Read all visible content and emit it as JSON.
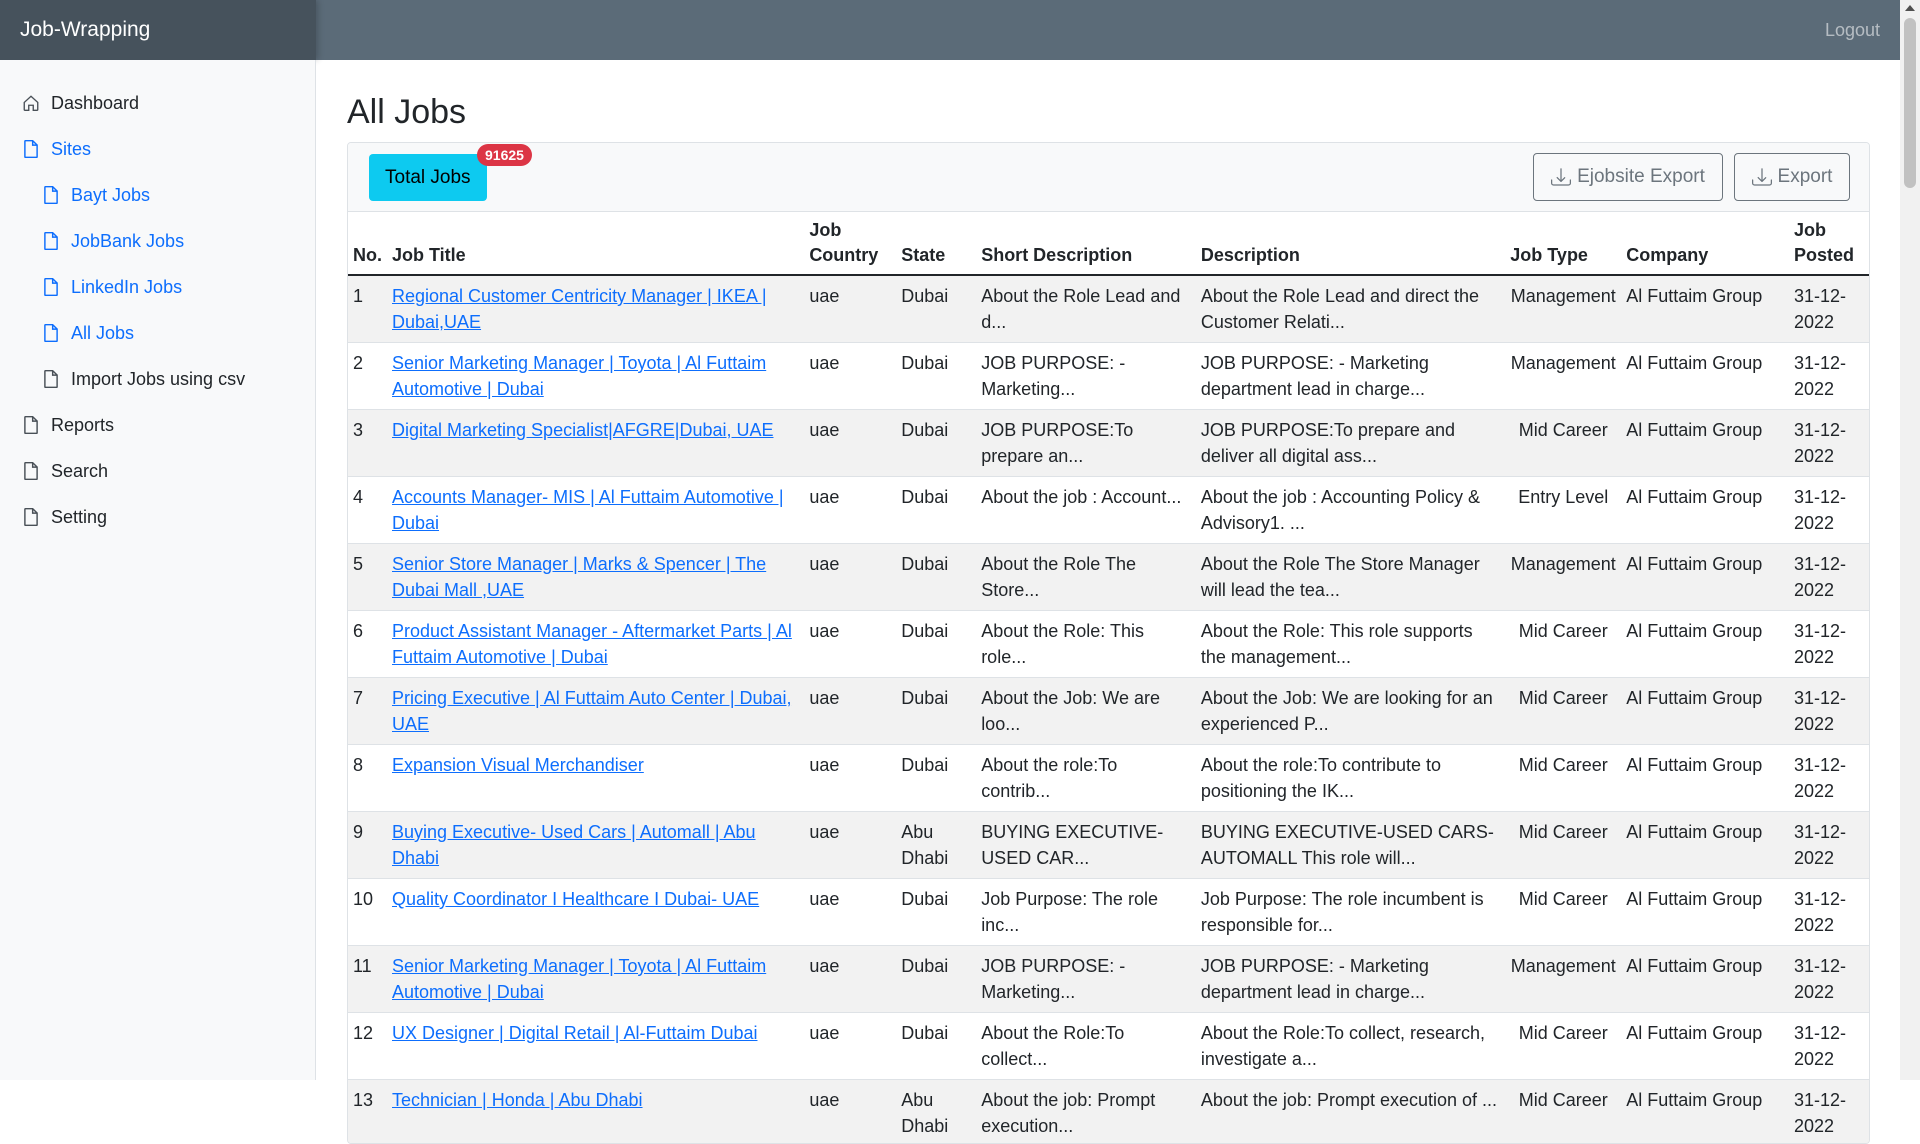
{
  "app": {
    "brand": "Job-Wrapping",
    "logout": "Logout"
  },
  "sidebar": {
    "items": [
      {
        "label": "Dashboard",
        "icon": "home-icon",
        "active": false,
        "sub": false
      },
      {
        "label": "Sites",
        "icon": "file-icon",
        "active": true,
        "sub": false
      },
      {
        "label": "Bayt Jobs",
        "icon": "file-icon",
        "active": true,
        "sub": true
      },
      {
        "label": "JobBank Jobs",
        "icon": "file-icon",
        "active": true,
        "sub": true
      },
      {
        "label": "LinkedIn Jobs",
        "icon": "file-icon",
        "active": true,
        "sub": true
      },
      {
        "label": "All Jobs",
        "icon": "file-icon",
        "active": true,
        "sub": true
      },
      {
        "label": "Import Jobs using csv",
        "icon": "file-icon",
        "active": false,
        "sub": true
      },
      {
        "label": "Reports",
        "icon": "file-icon",
        "active": false,
        "sub": false
      },
      {
        "label": "Search",
        "icon": "file-icon",
        "active": false,
        "sub": false
      },
      {
        "label": "Setting",
        "icon": "file-icon",
        "active": false,
        "sub": false
      }
    ]
  },
  "main": {
    "title": "All Jobs",
    "total_jobs_label": "Total Jobs",
    "total_jobs_count": "91625",
    "ejobsite_export": "Ejobsite Export",
    "export": "Export",
    "columns": [
      "No.",
      "Job Title",
      "Job Country",
      "State",
      "Short Description",
      "Description",
      "Job Type",
      "Company",
      "Job Posted"
    ],
    "rows": [
      {
        "no": "1",
        "title": "Regional Customer Centricity Manager | IKEA | Dubai,UAE",
        "country": "uae",
        "state": "Dubai",
        "short": "About the Role Lead and d...",
        "desc": "About the Role Lead and direct the Customer Relati...",
        "type": "Management",
        "company": "Al Futtaim Group",
        "posted": "31-12-2022"
      },
      {
        "no": "2",
        "title": "Senior Marketing Manager | Toyota | Al Futtaim Automotive | Dubai",
        "country": "uae",
        "state": "Dubai",
        "short": "JOB PURPOSE: - Marketing...",
        "desc": "JOB PURPOSE: - Marketing department lead in charge...",
        "type": "Management",
        "company": "Al Futtaim Group",
        "posted": "31-12-2022"
      },
      {
        "no": "3",
        "title": "Digital Marketing Specialist|AFGRE|Dubai, UAE",
        "country": "uae",
        "state": "Dubai",
        "short": "JOB PURPOSE:To prepare an...",
        "desc": "JOB PURPOSE:To prepare and deliver all digital ass...",
        "type": "Mid Career",
        "company": "Al Futtaim Group",
        "posted": "31-12-2022"
      },
      {
        "no": "4",
        "title": "Accounts Manager- MIS | Al Futtaim Automotive | Dubai",
        "country": "uae",
        "state": "Dubai",
        "short": "About the job :   Account...",
        "desc": "About the job :   Accounting Policy & Advisory1.  ...",
        "type": "Entry Level",
        "company": "Al Futtaim Group",
        "posted": "31-12-2022"
      },
      {
        "no": "5",
        "title": "Senior Store Manager | Marks & Spencer | The Dubai Mall ,UAE",
        "country": "uae",
        "state": "Dubai",
        "short": "About the Role The Store...",
        "desc": "About the Role The Store Manager will lead the tea...",
        "type": "Management",
        "company": "Al Futtaim Group",
        "posted": "31-12-2022"
      },
      {
        "no": "6",
        "title": "Product Assistant Manager - Aftermarket Parts | Al Futtaim Automotive | Dubai",
        "country": "uae",
        "state": "Dubai",
        "short": "About the Role: This role...",
        "desc": "About the Role: This role supports the management...",
        "type": "Mid Career",
        "company": "Al Futtaim Group",
        "posted": "31-12-2022"
      },
      {
        "no": "7",
        "title": "Pricing Executive | Al Futtaim Auto Center | Dubai, UAE",
        "country": "uae",
        "state": "Dubai",
        "short": "About the Job: We are loo...",
        "desc": "About the Job: We are looking for an experienced P...",
        "type": "Mid Career",
        "company": "Al Futtaim Group",
        "posted": "31-12-2022"
      },
      {
        "no": "8",
        "title": "Expansion Visual Merchandiser",
        "country": "uae",
        "state": "Dubai",
        "short": "About the role:To contrib...",
        "desc": "About the role:To contribute to positioning the IK...",
        "type": "Mid Career",
        "company": "Al Futtaim Group",
        "posted": "31-12-2022"
      },
      {
        "no": "9",
        "title": "Buying Executive- Used Cars | Automall | Abu Dhabi",
        "country": "uae",
        "state": "Abu Dhabi",
        "short": "BUYING EXECUTIVE-USED CAR...",
        "desc": "BUYING EXECUTIVE-USED CARS-AUTOMALL This role will...",
        "type": "Mid Career",
        "company": "Al Futtaim Group",
        "posted": "31-12-2022"
      },
      {
        "no": "10",
        "title": "Quality Coordinator I Healthcare I Dubai- UAE",
        "country": "uae",
        "state": "Dubai",
        "short": "Job Purpose: The role inc...",
        "desc": "Job Purpose: The role incumbent is responsible for...",
        "type": "Mid Career",
        "company": "Al Futtaim Group",
        "posted": "31-12-2022"
      },
      {
        "no": "11",
        "title": "Senior Marketing Manager | Toyota | Al Futtaim Automotive | Dubai",
        "country": "uae",
        "state": "Dubai",
        "short": "JOB PURPOSE: - Marketing...",
        "desc": "JOB PURPOSE: - Marketing department lead in charge...",
        "type": "Management",
        "company": "Al Futtaim Group",
        "posted": "31-12-2022"
      },
      {
        "no": "12",
        "title": "UX Designer | Digital Retail | Al-Futtaim Dubai",
        "country": "uae",
        "state": "Dubai",
        "short": "About the Role:To collect...",
        "desc": "About the Role:To collect, research, investigate a...",
        "type": "Mid Career",
        "company": "Al Futtaim Group",
        "posted": "31-12-2022"
      },
      {
        "no": "13",
        "title": "Technician | Honda | Abu Dhabi",
        "country": "uae",
        "state": "Abu Dhabi",
        "short": "About the job: Prompt execution...",
        "desc": "About the job: Prompt execution of ...",
        "type": "Mid Career",
        "company": "Al Futtaim Group",
        "posted": "31-12-2022"
      }
    ]
  },
  "colors": {
    "accent": "#0d6efd",
    "topbar": "#5b6b78",
    "brand_bg": "#46525c",
    "info": "#0dcaf0",
    "badge": "#dc3545"
  }
}
